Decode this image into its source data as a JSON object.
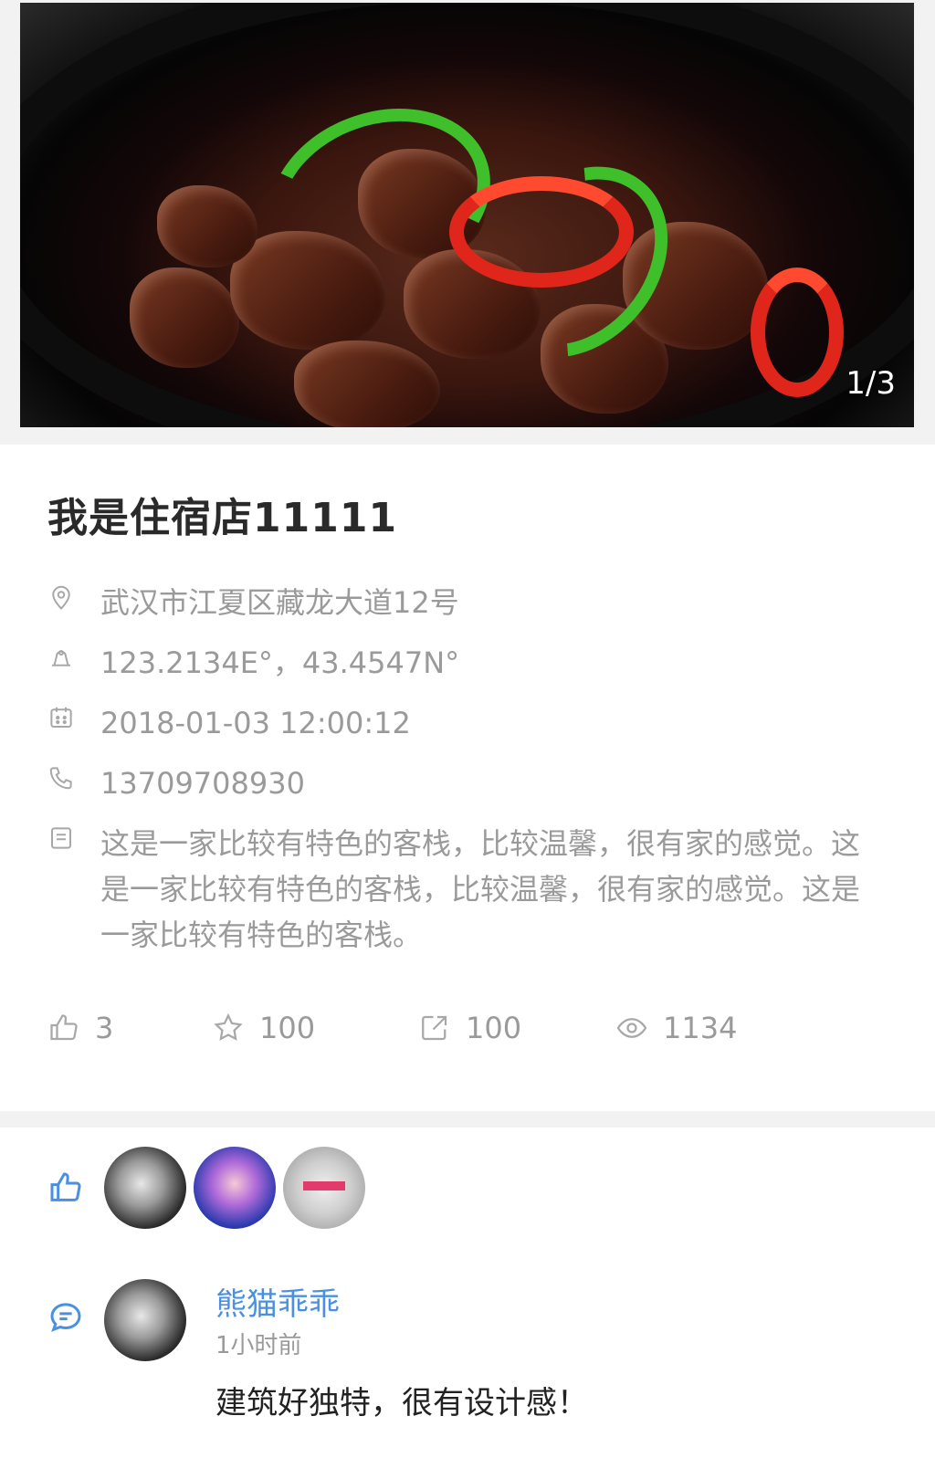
{
  "gallery": {
    "counter": "1/3"
  },
  "shop": {
    "name": "我是住宿店11111",
    "address": "武汉市江夏区藏龙大道12号",
    "coordinates": "123.2134E°，43.4547N°",
    "datetime": "2018-01-03  12:00:12",
    "phone": "13709708930",
    "description": "这是一家比较有特色的客栈，比较温馨，很有家的感觉。这是一家比较有特色的客栈，比较温馨，很有家的感觉。这是一家比较有特色的客栈。"
  },
  "stats": {
    "likes": "3",
    "favorites": "100",
    "shares": "100",
    "views": "1134"
  },
  "icons": {
    "address": "location-pin-icon",
    "coordinates": "coordinates-icon",
    "datetime": "calendar-icon",
    "phone": "phone-icon",
    "description": "note-icon",
    "likes": "thumbs-up-icon",
    "favorites": "star-icon",
    "shares": "share-icon",
    "views": "eye-icon",
    "liked_by": "thumbs-up-icon",
    "comments": "comment-icon"
  },
  "colors": {
    "accent": "#4a90e2",
    "text_secondary": "#9a9a9a",
    "page_bg": "#f2f2f2"
  },
  "liked_by": [
    {
      "avatar": "avatar-1"
    },
    {
      "avatar": "avatar-2"
    },
    {
      "avatar": "avatar-3"
    }
  ],
  "comments": [
    {
      "user": "熊猫乖乖",
      "time": "1小时前",
      "text": "建筑好独特，很有设计感！"
    }
  ]
}
